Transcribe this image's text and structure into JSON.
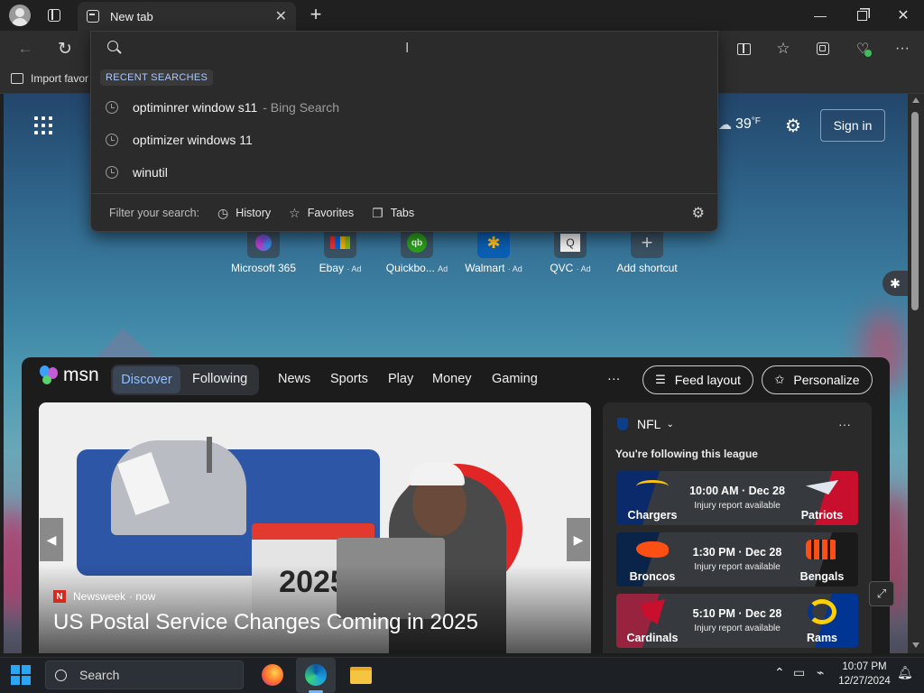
{
  "browser": {
    "tab_title": "New tab",
    "favorites_bar_item": "Import favor"
  },
  "search_dropdown": {
    "heading": "RECENT SEARCHES",
    "items": [
      {
        "text": "optiminrer window s11",
        "suffix": "- Bing Search"
      },
      {
        "text": "optimizer windows 11",
        "suffix": ""
      },
      {
        "text": "winutil",
        "suffix": ""
      }
    ],
    "filter_label": "Filter your search:",
    "filters": [
      "History",
      "Favorites",
      "Tabs"
    ]
  },
  "weather": {
    "temp": "39",
    "unit": "°F"
  },
  "signin_label": "Sign in",
  "shortcuts": [
    {
      "label": "Microsoft 365",
      "ad": ""
    },
    {
      "label": "Ebay",
      "ad": "· Ad"
    },
    {
      "label": "Quickbo...",
      "ad": "Ad"
    },
    {
      "label": "Walmart",
      "ad": "· Ad"
    },
    {
      "label": "QVC",
      "ad": "· Ad"
    },
    {
      "label": "Add shortcut",
      "ad": ""
    }
  ],
  "msn": {
    "logo": "msn",
    "tabs": {
      "discover": "Discover",
      "following": "Following"
    },
    "nav": [
      "News",
      "Sports",
      "Play",
      "Money",
      "Gaming"
    ],
    "more": "···",
    "feed_layout": "Feed layout",
    "personalize": "Personalize"
  },
  "hero": {
    "source": "Newsweek",
    "age": "· now",
    "headline": "US Postal Service Changes Coming in 2025",
    "year": "2025"
  },
  "nfl": {
    "league": "NFL",
    "following": "You're following this league",
    "games": [
      {
        "home": "Chargers",
        "away": "Patriots",
        "time": "10:00 AM · Dec 28",
        "note": "Injury report available",
        "home_color": "#0a2a6b",
        "away_color": "#c8102e"
      },
      {
        "home": "Broncos",
        "away": "Bengals",
        "time": "1:30 PM · Dec 28",
        "note": "Injury report available",
        "home_color": "#0a2349",
        "away_color": "#1a1a1a"
      },
      {
        "home": "Cardinals",
        "away": "Rams",
        "time": "5:10 PM · Dec 28",
        "note": "Injury report available",
        "home_color": "#97233f",
        "away_color": "#003594"
      }
    ]
  },
  "taskbar": {
    "search_placeholder": "Search",
    "time": "10:07 PM",
    "date": "12/27/2024"
  }
}
